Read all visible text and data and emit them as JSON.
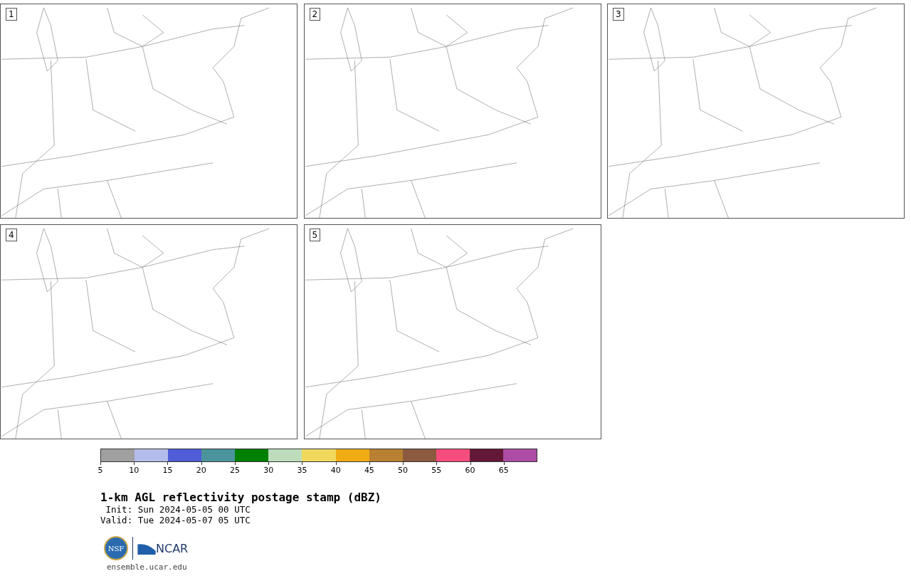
{
  "panels": [
    {
      "label": "1"
    },
    {
      "label": "2"
    },
    {
      "label": "3"
    },
    {
      "label": "4"
    },
    {
      "label": "5"
    }
  ],
  "colorbar": {
    "bins": [
      {
        "label": "5",
        "color": "#a0a0a0"
      },
      {
        "label": "10",
        "color": "#b4bcec"
      },
      {
        "label": "15",
        "color": "#505cd8"
      },
      {
        "label": "20",
        "color": "#4c949c"
      },
      {
        "label": "25",
        "color": "#008000"
      },
      {
        "label": "30",
        "color": "#bcdcbc"
      },
      {
        "label": "35",
        "color": "#f0d85c"
      },
      {
        "label": "40",
        "color": "#f0ac14"
      },
      {
        "label": "45",
        "color": "#b88030"
      },
      {
        "label": "50",
        "color": "#8c5a40"
      },
      {
        "label": "55",
        "color": "#f44c7c"
      },
      {
        "label": "60",
        "color": "#641838"
      },
      {
        "label": "65",
        "color": "#ac4ca4"
      }
    ]
  },
  "title": "1-km AGL reflectivity postage stamp (dBZ)",
  "init": " Init: Sun 2024-05-05 00 UTC",
  "valid": "Valid: Tue 2024-05-07 05 UTC",
  "logo": {
    "nsf": "NSF",
    "ncar": "NCAR"
  },
  "footer": "ensemble.ucar.edu"
}
